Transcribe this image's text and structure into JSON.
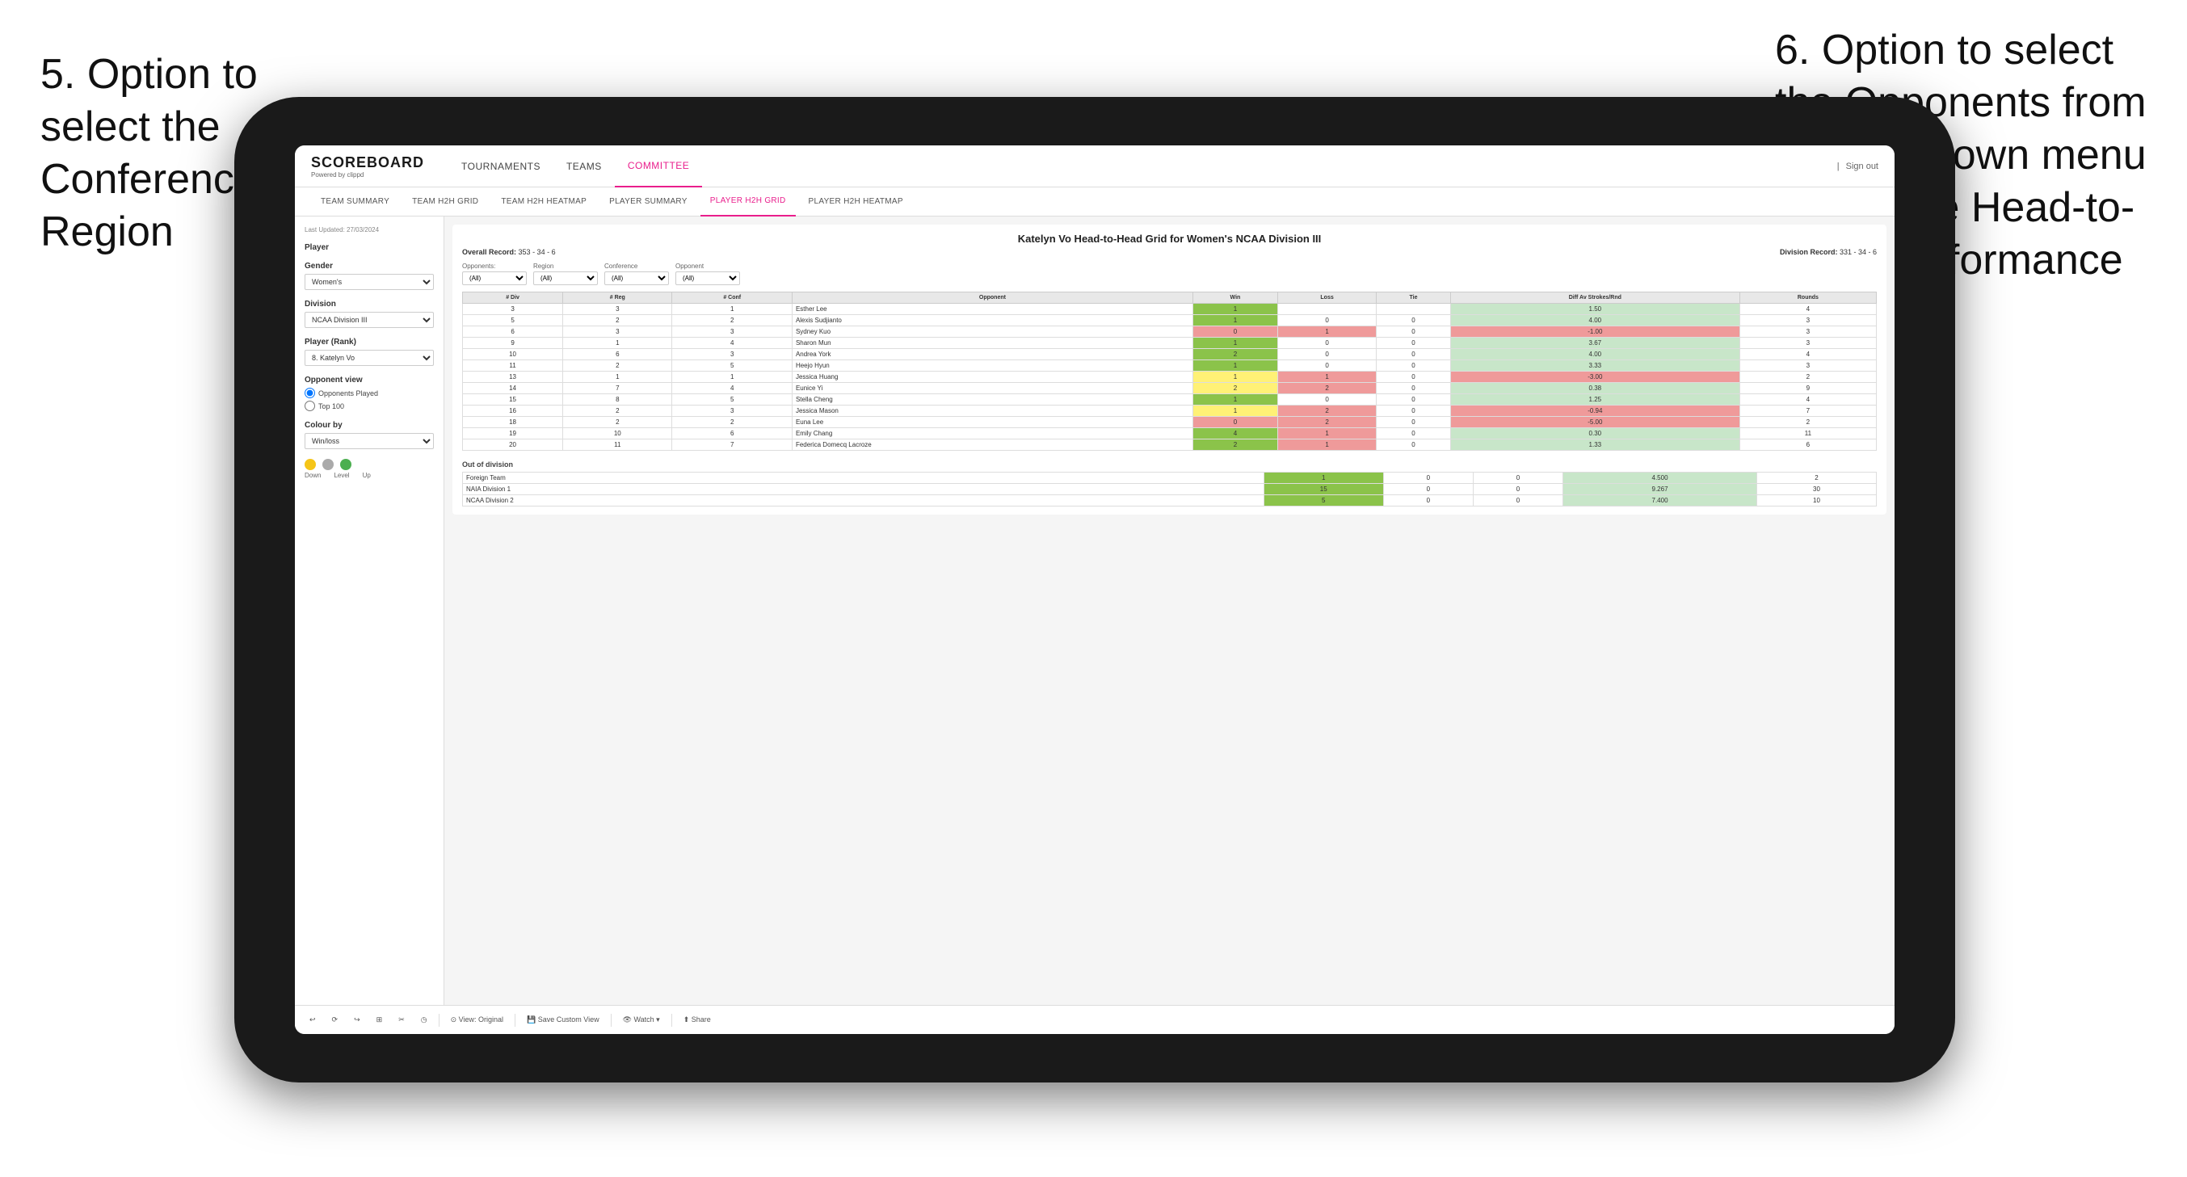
{
  "annotations": {
    "left": "5. Option to select the Conference and Region",
    "right": "6. Option to select the Opponents from the dropdown menu to see the Head-to-Head performance"
  },
  "header": {
    "logo": "SCOREBOARD",
    "logo_sub": "Powered by clippd",
    "nav": [
      "TOURNAMENTS",
      "TEAMS",
      "COMMITTEE"
    ],
    "sign_out": "Sign out",
    "separator": "|"
  },
  "sub_nav": [
    "TEAM SUMMARY",
    "TEAM H2H GRID",
    "TEAM H2H HEATMAP",
    "PLAYER SUMMARY",
    "PLAYER H2H GRID",
    "PLAYER H2H HEATMAP"
  ],
  "left_panel": {
    "last_updated": "Last Updated: 27/03/2024",
    "player_label": "Player",
    "gender_label": "Gender",
    "gender_value": "Women's",
    "division_label": "Division",
    "division_value": "NCAA Division III",
    "player_rank_label": "Player (Rank)",
    "player_rank_value": "8. Katelyn Vo",
    "opponent_view_label": "Opponent view",
    "radio_1": "Opponents Played",
    "radio_2": "Top 100",
    "colour_label": "Colour by",
    "colour_value": "Win/loss",
    "legend": [
      "Down",
      "Level",
      "Up"
    ]
  },
  "grid": {
    "title": "Katelyn Vo Head-to-Head Grid for Women's NCAA Division III",
    "overall_record_label": "Overall Record:",
    "overall_record": "353 - 34 - 6",
    "division_record_label": "Division Record:",
    "division_record": "331 - 34 - 6",
    "filter_opponents_label": "Opponents:",
    "filter_region_label": "Region",
    "filter_conference_label": "Conference",
    "filter_opponent_label": "Opponent",
    "filter_all": "(All)",
    "col_headers": [
      "# Div",
      "# Reg",
      "# Conf",
      "Opponent",
      "Win",
      "Loss",
      "Tie",
      "Diff Av Strokes/Rnd",
      "Rounds"
    ],
    "rows": [
      {
        "div": "3",
        "reg": "3",
        "conf": "1",
        "opponent": "Esther Lee",
        "win": "1",
        "loss": "",
        "tie": "",
        "diff": "1.50",
        "rounds": "4",
        "win_color": "green"
      },
      {
        "div": "5",
        "reg": "2",
        "conf": "2",
        "opponent": "Alexis Sudjianto",
        "win": "1",
        "loss": "0",
        "tie": "0",
        "diff": "4.00",
        "rounds": "3",
        "win_color": "green"
      },
      {
        "div": "6",
        "reg": "3",
        "conf": "3",
        "opponent": "Sydney Kuo",
        "win": "0",
        "loss": "1",
        "tie": "0",
        "diff": "-1.00",
        "rounds": "3",
        "win_color": "red"
      },
      {
        "div": "9",
        "reg": "1",
        "conf": "4",
        "opponent": "Sharon Mun",
        "win": "1",
        "loss": "0",
        "tie": "0",
        "diff": "3.67",
        "rounds": "3",
        "win_color": "green"
      },
      {
        "div": "10",
        "reg": "6",
        "conf": "3",
        "opponent": "Andrea York",
        "win": "2",
        "loss": "0",
        "tie": "0",
        "diff": "4.00",
        "rounds": "4",
        "win_color": "green"
      },
      {
        "div": "11",
        "reg": "2",
        "conf": "5",
        "opponent": "Heejo Hyun",
        "win": "1",
        "loss": "0",
        "tie": "0",
        "diff": "3.33",
        "rounds": "3",
        "win_color": "green"
      },
      {
        "div": "13",
        "reg": "1",
        "conf": "1",
        "opponent": "Jessica Huang",
        "win": "1",
        "loss": "1",
        "tie": "0",
        "diff": "-3.00",
        "rounds": "2",
        "win_color": "yellow"
      },
      {
        "div": "14",
        "reg": "7",
        "conf": "4",
        "opponent": "Eunice Yi",
        "win": "2",
        "loss": "2",
        "tie": "0",
        "diff": "0.38",
        "rounds": "9",
        "win_color": "yellow"
      },
      {
        "div": "15",
        "reg": "8",
        "conf": "5",
        "opponent": "Stella Cheng",
        "win": "1",
        "loss": "0",
        "tie": "0",
        "diff": "1.25",
        "rounds": "4",
        "win_color": "green"
      },
      {
        "div": "16",
        "reg": "2",
        "conf": "3",
        "opponent": "Jessica Mason",
        "win": "1",
        "loss": "2",
        "tie": "0",
        "diff": "-0.94",
        "rounds": "7",
        "win_color": "yellow"
      },
      {
        "div": "18",
        "reg": "2",
        "conf": "2",
        "opponent": "Euna Lee",
        "win": "0",
        "loss": "2",
        "tie": "0",
        "diff": "-5.00",
        "rounds": "2",
        "win_color": "red"
      },
      {
        "div": "19",
        "reg": "10",
        "conf": "6",
        "opponent": "Emily Chang",
        "win": "4",
        "loss": "1",
        "tie": "0",
        "diff": "0.30",
        "rounds": "11",
        "win_color": "green"
      },
      {
        "div": "20",
        "reg": "11",
        "conf": "7",
        "opponent": "Federica Domecq Lacroze",
        "win": "2",
        "loss": "1",
        "tie": "0",
        "diff": "1.33",
        "rounds": "6",
        "win_color": "green"
      }
    ],
    "out_of_division_label": "Out of division",
    "out_rows": [
      {
        "opponent": "Foreign Team",
        "win": "1",
        "loss": "0",
        "tie": "0",
        "diff": "4.500",
        "rounds": "2"
      },
      {
        "opponent": "NAIA Division 1",
        "win": "15",
        "loss": "0",
        "tie": "0",
        "diff": "9.267",
        "rounds": "30"
      },
      {
        "opponent": "NCAA Division 2",
        "win": "5",
        "loss": "0",
        "tie": "0",
        "diff": "7.400",
        "rounds": "10"
      }
    ]
  },
  "toolbar": {
    "buttons": [
      "View: Original",
      "Save Custom View",
      "Watch ▾",
      "Share"
    ]
  }
}
